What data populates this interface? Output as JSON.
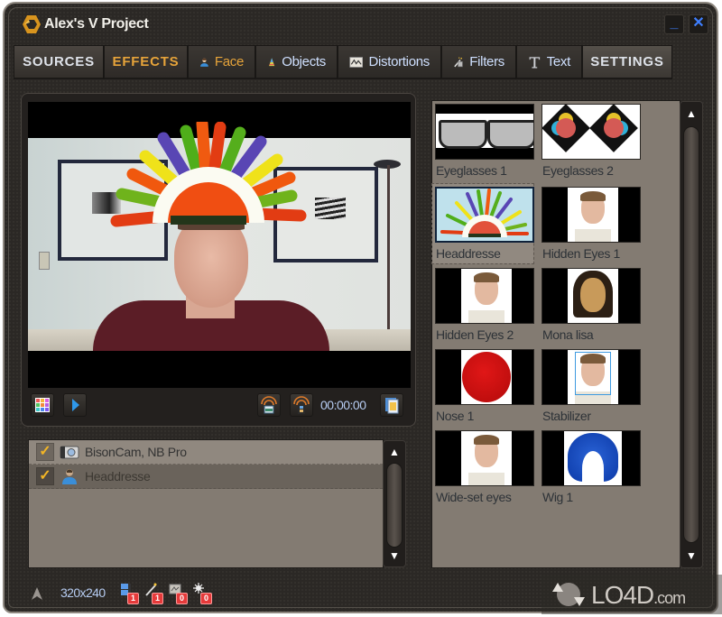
{
  "window": {
    "title": "Alex's V Project",
    "minimize_label": "_",
    "close_label": "✕"
  },
  "tabs": {
    "main": [
      {
        "label": "SOURCES",
        "icon": null,
        "active": false
      },
      {
        "label": "EFFECTS",
        "icon": null,
        "active": true
      }
    ],
    "sub": [
      {
        "label": "Face",
        "icon": "person-icon",
        "selected": true
      },
      {
        "label": "Objects",
        "icon": "party-hat-icon",
        "selected": false
      },
      {
        "label": "Distortions",
        "icon": "distortion-icon",
        "selected": false
      },
      {
        "label": "Filters",
        "icon": "magic-wand-icon",
        "selected": false
      },
      {
        "label": "Text",
        "icon": "text-t-icon",
        "selected": false
      }
    ],
    "settings": {
      "label": "SETTINGS"
    }
  },
  "preview": {
    "timecode": "00:00:00",
    "controls": [
      "grid-icon",
      "play-icon",
      "snapshot-icon",
      "record-video-icon",
      "gallery-icon"
    ]
  },
  "layers": [
    {
      "label": "BisonCam, NB Pro",
      "checked": true,
      "icon": "webcam-icon"
    },
    {
      "label": "Headdresse",
      "checked": true,
      "icon": "person-icon"
    }
  ],
  "effects": [
    {
      "label": "Eyeglasses 1",
      "selected": false
    },
    {
      "label": "Eyeglasses 2",
      "selected": false
    },
    {
      "label": "Headdresse",
      "selected": true
    },
    {
      "label": "Hidden Eyes 1",
      "selected": false
    },
    {
      "label": "Hidden Eyes 2",
      "selected": false
    },
    {
      "label": "Mona lisa",
      "selected": false
    },
    {
      "label": "Nose 1",
      "selected": false
    },
    {
      "label": "Stabilizer",
      "selected": false
    },
    {
      "label": "Wide-set eyes",
      "selected": false
    },
    {
      "label": "Wig 1",
      "selected": false
    }
  ],
  "status": {
    "resolution": "320x240",
    "counters": [
      {
        "icon": "sources-icon",
        "count": "1"
      },
      {
        "icon": "effects-wand-icon",
        "count": "1"
      },
      {
        "icon": "distortion-icon",
        "count": "0"
      },
      {
        "icon": "filter-sparkle-icon",
        "count": "0"
      }
    ]
  },
  "watermark": {
    "brand": "LO4D",
    "suffix": ".com"
  },
  "colors": {
    "accent_orange": "#e7a43a",
    "tab_text": "#cfe0ff",
    "panel_bg": "#837b72",
    "badge_red": "#e53a3a",
    "window_close_blue": "#3f7fff"
  }
}
